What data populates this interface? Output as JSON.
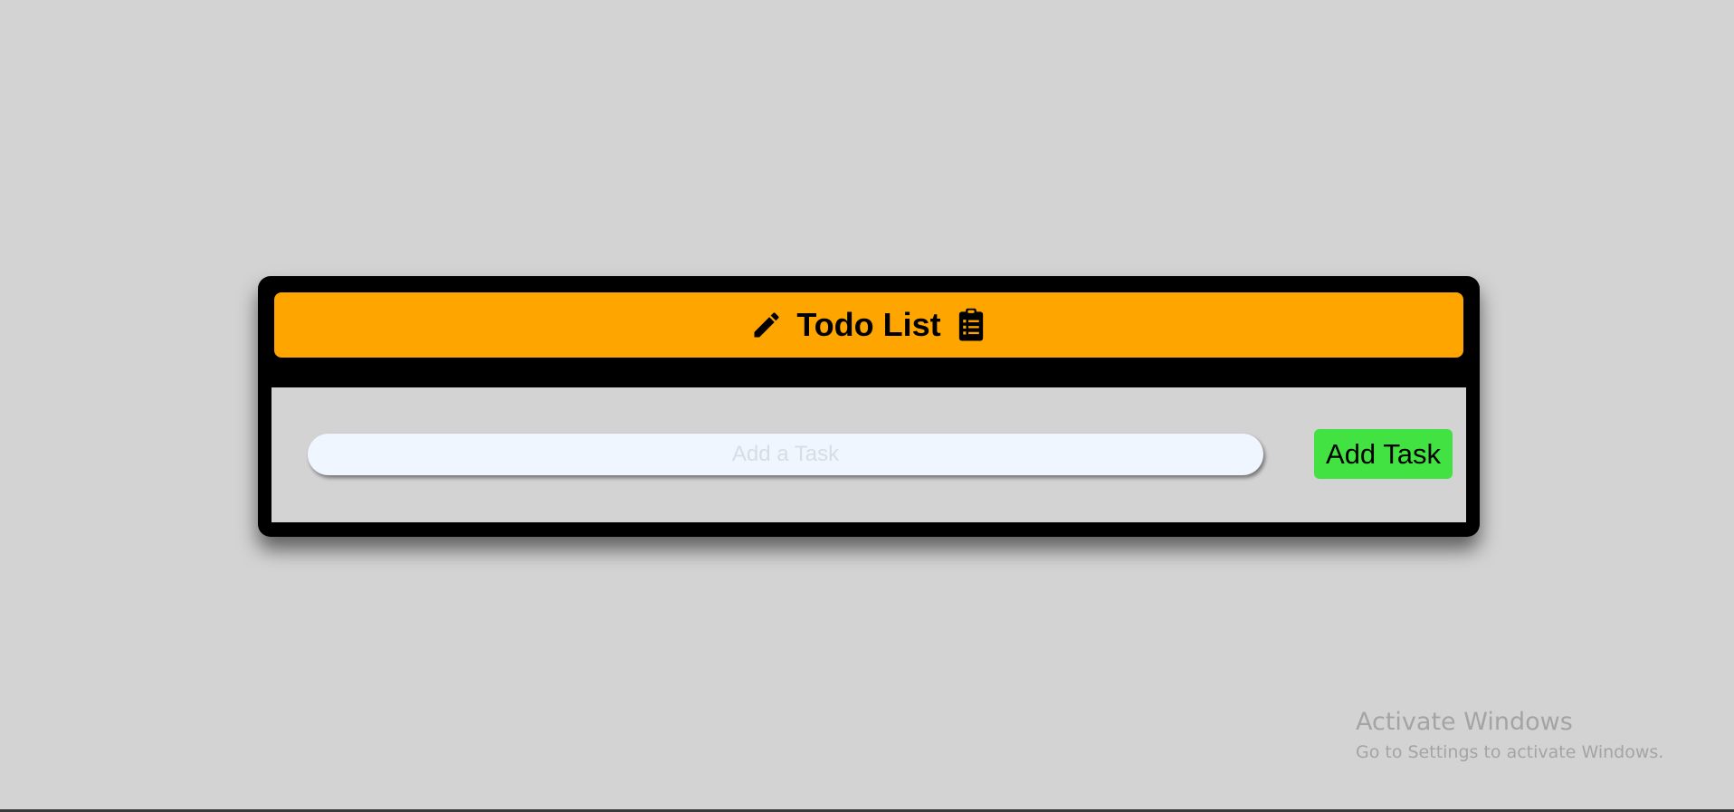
{
  "app": {
    "title": "Todo List",
    "header_left_icon": "pencil-icon",
    "header_right_icon": "clipboard-list-icon"
  },
  "form": {
    "input_placeholder": "Add a Task",
    "input_value": "",
    "add_button_label": "Add Task"
  },
  "watermark": {
    "title": "Activate Windows",
    "subtitle": "Go to Settings to activate Windows."
  },
  "colors": {
    "page_background": "#d3d3d3",
    "card_background": "#000000",
    "header_background": "#ffa500",
    "add_button_background": "#41e241",
    "input_background": "#f0f6ff"
  }
}
